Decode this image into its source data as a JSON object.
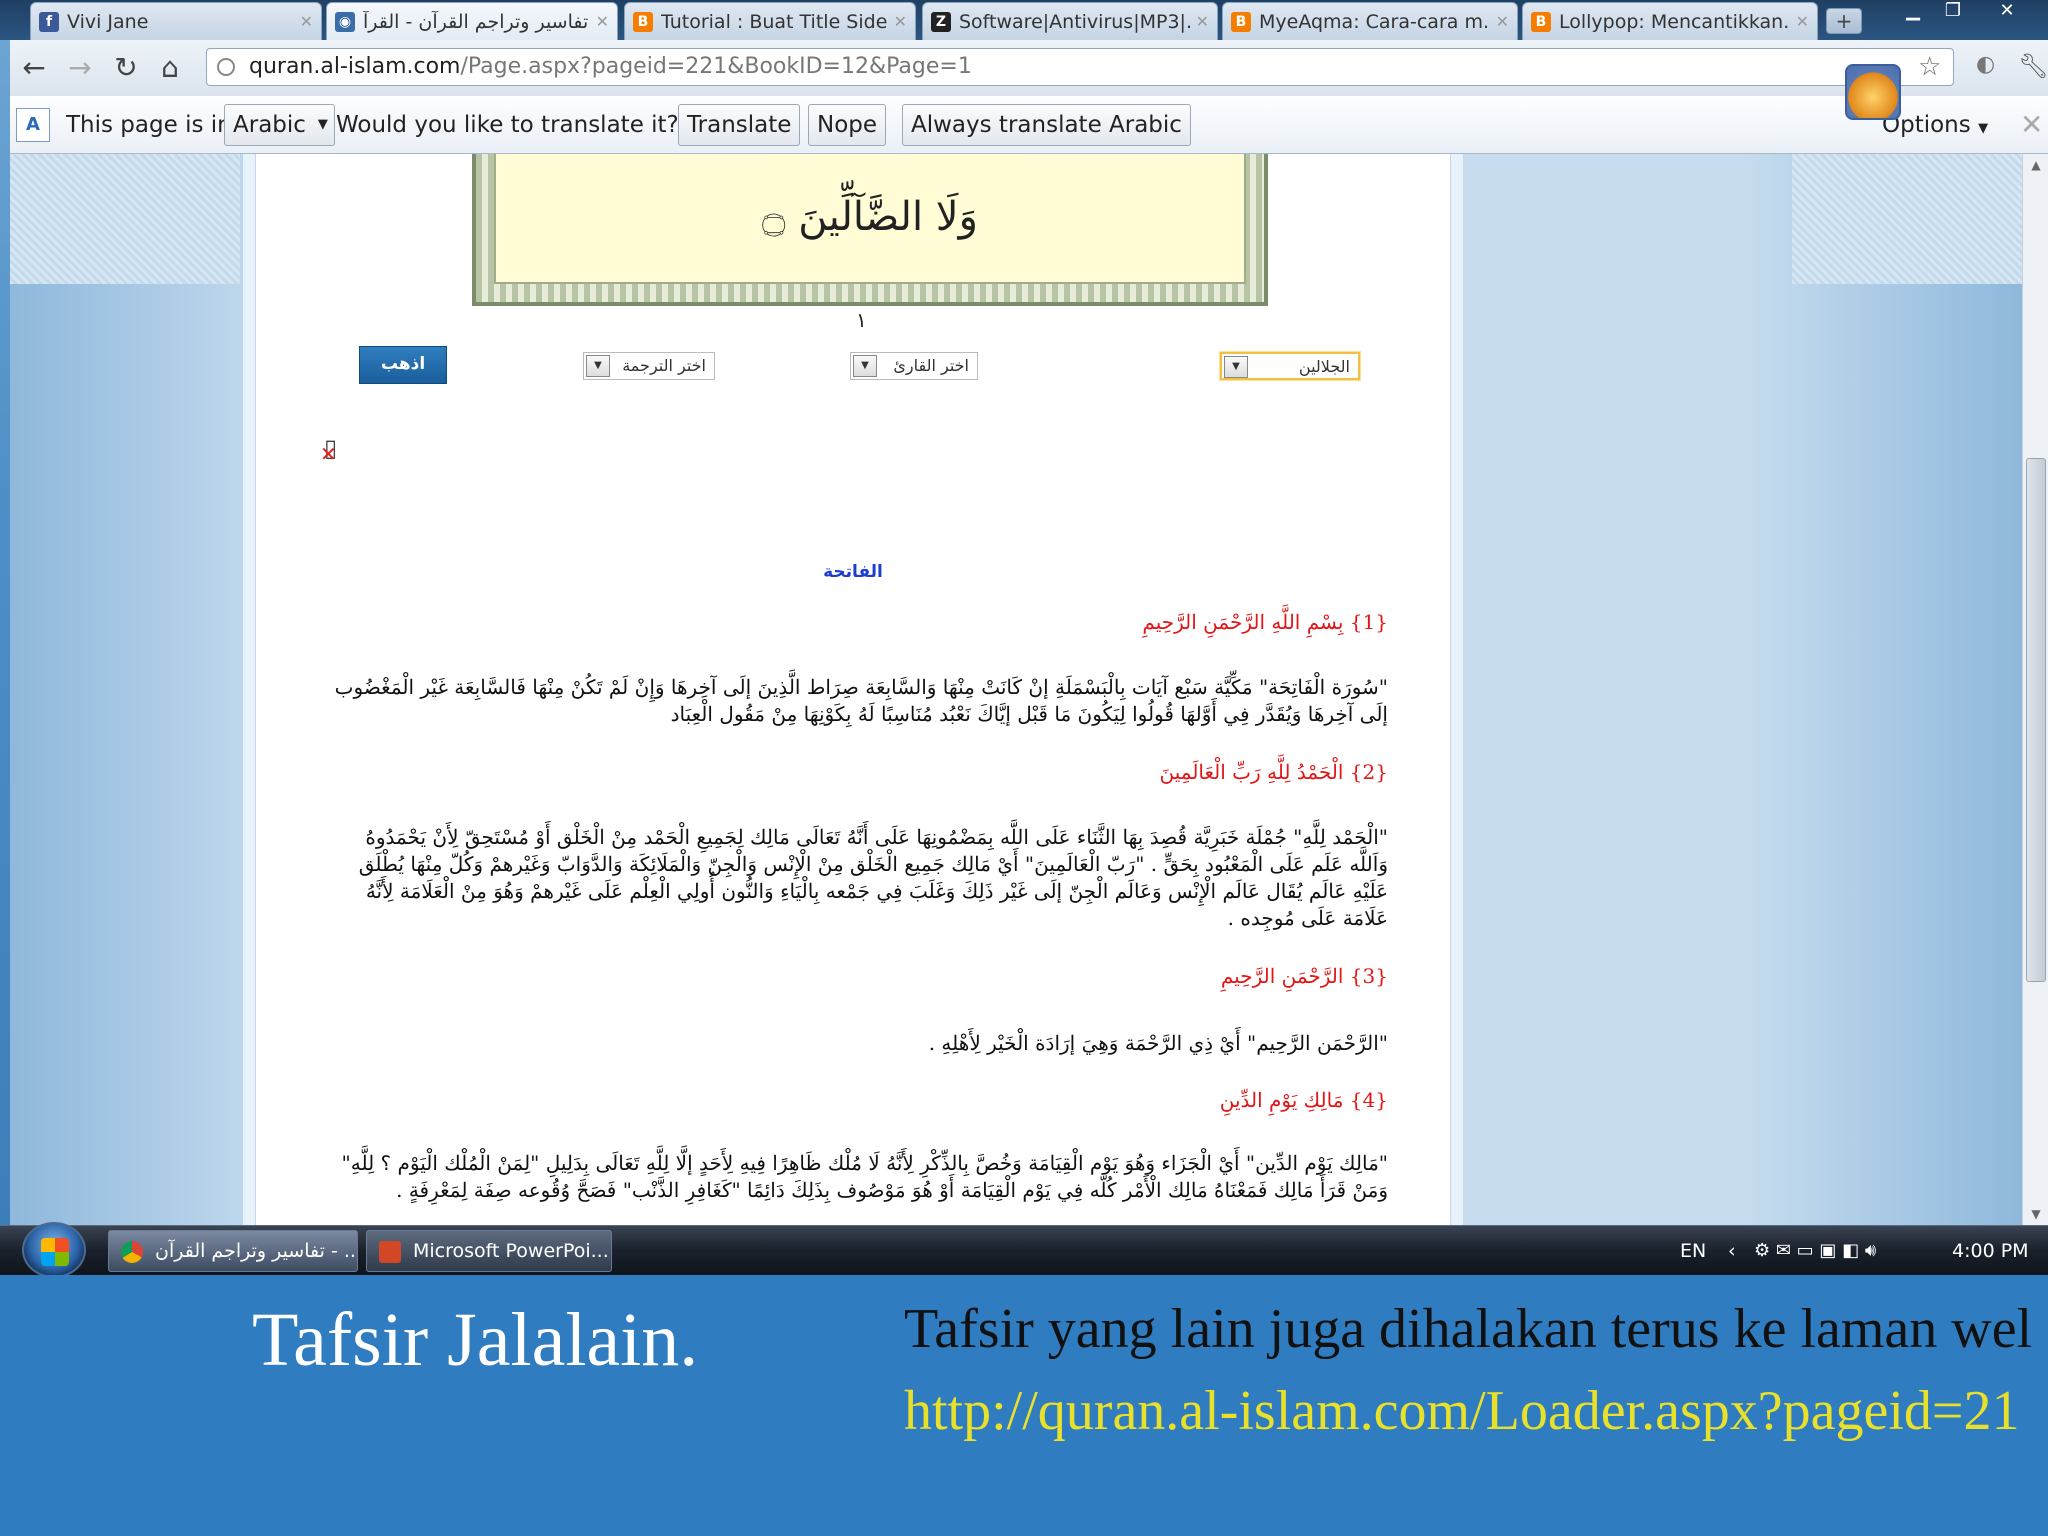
{
  "browser": {
    "tabs": [
      {
        "label": "Vivi Jane",
        "favicon": "facebook-icon",
        "color": "#3b5998"
      },
      {
        "label": "تفاسير وتراجم القرآن - القرآ...",
        "favicon": "quran-site-icon",
        "color": "#3a6ea8"
      },
      {
        "label": "Tutorial : Buat Title Side...",
        "favicon": "blogger-icon",
        "color": "#f57d00"
      },
      {
        "label": "Software|Antivirus|MP3|...",
        "favicon": "z-icon",
        "color": "#222222"
      },
      {
        "label": "MyeAqma: Cara-cara m...",
        "favicon": "blogger-icon",
        "color": "#f57d00"
      },
      {
        "label": "Lollypop: Mencantikkan...",
        "favicon": "blogger-icon",
        "color": "#f57d00"
      }
    ],
    "url_host": "quran.al-islam.com",
    "url_path": "/Page.aspx?pageid=221&BookID=12&Page=1"
  },
  "translate_bar": {
    "prefix": "This page is in",
    "language": "Arabic",
    "question": "Would you like to translate it?",
    "translate_label": "Translate",
    "nope_label": "Nope",
    "always_label": "Always translate Arabic",
    "options_label": "Options"
  },
  "quran": {
    "verse_text": "وَلَا الضَّآلِّينَ ۝",
    "page_number": "١",
    "go_button": "اذهب",
    "select_tafsir": "الجلالين",
    "select_reader": "اختر القارئ",
    "select_translation": "اختر الترجمة",
    "surah_title": "الفاتحة"
  },
  "tafsir": {
    "verses": [
      {
        "heading": "{1} بِسْمِ اللَّهِ الرَّحْمَنِ الرَّحِيمِ",
        "text": "\"سُورَة الْفَاتِحَة\" مَكِّيَّة سَبْع آيَات بِالْبَسْمَلَةِ إنْ كَانَتْ مِنْهَا وَالسَّابِعَة صِرَاط الَّذِينَ إلَى آخِرهَا وَإِنْ لَمْ تَكُنْ مِنْهَا فَالسَّابِعَة غَيْر الْمَغْضُوب إلَى آخِرهَا وَيُقَدَّر فِي أَوَّلهَا قُولُوا لِيَكُونَ مَا قَبْل إيَّاكَ نَعْبُد مُنَاسِبًا لَهُ بِكَوْنِهَا مِنْ مَقُول الْعِبَاد"
      },
      {
        "heading": "{2} الْحَمْدُ لِلَّهِ رَبِّ الْعَالَمِينَ",
        "text": "\"الْحَمْد لِلَّهِ\" جُمْلَة خَبَرِيَّة قُصِدَ بِهَا الثَّنَاء عَلَى اللَّه بِمَضْمُونِهَا عَلَى أَنَّهُ تَعَالَى مَالِك لِجَمِيعِ الْحَمْد مِنْ الْخَلْق أَوْ مُسْتَحِقّ لِأَنْ يَحْمَدُوهُ وَاَللَّه عَلَم عَلَى الْمَعْبُود بِحَقٍّ . \"رَبّ الْعَالَمِينَ\" أَيْ مَالِك جَمِيع الْخَلْق مِنْ الْإِنْس وَالْجِنّ وَالْمَلَائِكَة وَالدَّوَابّ وَغَيْرهمْ وَكُلّ مِنْهَا يُطْلَق عَلَيْهِ عَالَم يُقَال عَالَم الْإِنْس وَعَالَم الْجِنّ إلَى غَيْر ذَلِكَ وَغَلَبَ فِي جَمْعه بِالْيَاءِ وَالنُّون أُولِي الْعِلْم عَلَى غَيْرهمْ وَهُوَ مِنْ الْعَلَامَة لِأَنَّهُ عَلَامَة عَلَى مُوجِده ."
      },
      {
        "heading": "{3} الرَّحْمَنِ الرَّحِيمِ",
        "text": "\"الرَّحْمَن الرَّحِيم\" أَيْ ذِي الرَّحْمَة وَهِيَ إرَادَة الْخَيْر لِأَهْلِهِ ."
      },
      {
        "heading": "{4} مَالِكِ يَوْمِ الدِّينِ",
        "text": "\"مَالِك يَوْم الدِّين\" أَيْ الْجَزَاء وَهُوَ يَوْم الْقِيَامَة وَخُصَّ بِالذِّكْرِ لِأَنَّهُ لَا مُلْك ظَاهِرًا فِيهِ لِأَحَدٍ إلَّا لِلَّهِ تَعَالَى بِدَلِيلِ \"لِمَنْ الْمُلْك الْيَوْم ؟ لِلَّهِ\" وَمَنْ قَرَأَ مَالِك فَمَعْنَاهُ مَالِك الْأَمْر كُلّه فِي يَوْم الْقِيَامَة أَوْ هُوَ مَوْصُوف بِذَلِكَ دَائِمًا \"كَغَافِرِ الذَّنْب\" فَصَحَّ وُقُوعه صِفَة لِمَعْرِفَةٍ ."
      }
    ]
  },
  "taskbar": {
    "items": [
      {
        "label": "تفاسير وتراجم القرآن - ...",
        "icon": "chrome-icon"
      },
      {
        "label": "Microsoft PowerPoi...",
        "icon": "powerpoint-icon"
      }
    ],
    "lang": "EN",
    "clock": "4:00 PM"
  },
  "slide": {
    "title": "Tafsir Jalalain.",
    "text": "Tafsir yang lain juga dihalakan terus ke laman wel",
    "url": "http://quran.al-islam.com/Loader.aspx?pageid=21"
  }
}
